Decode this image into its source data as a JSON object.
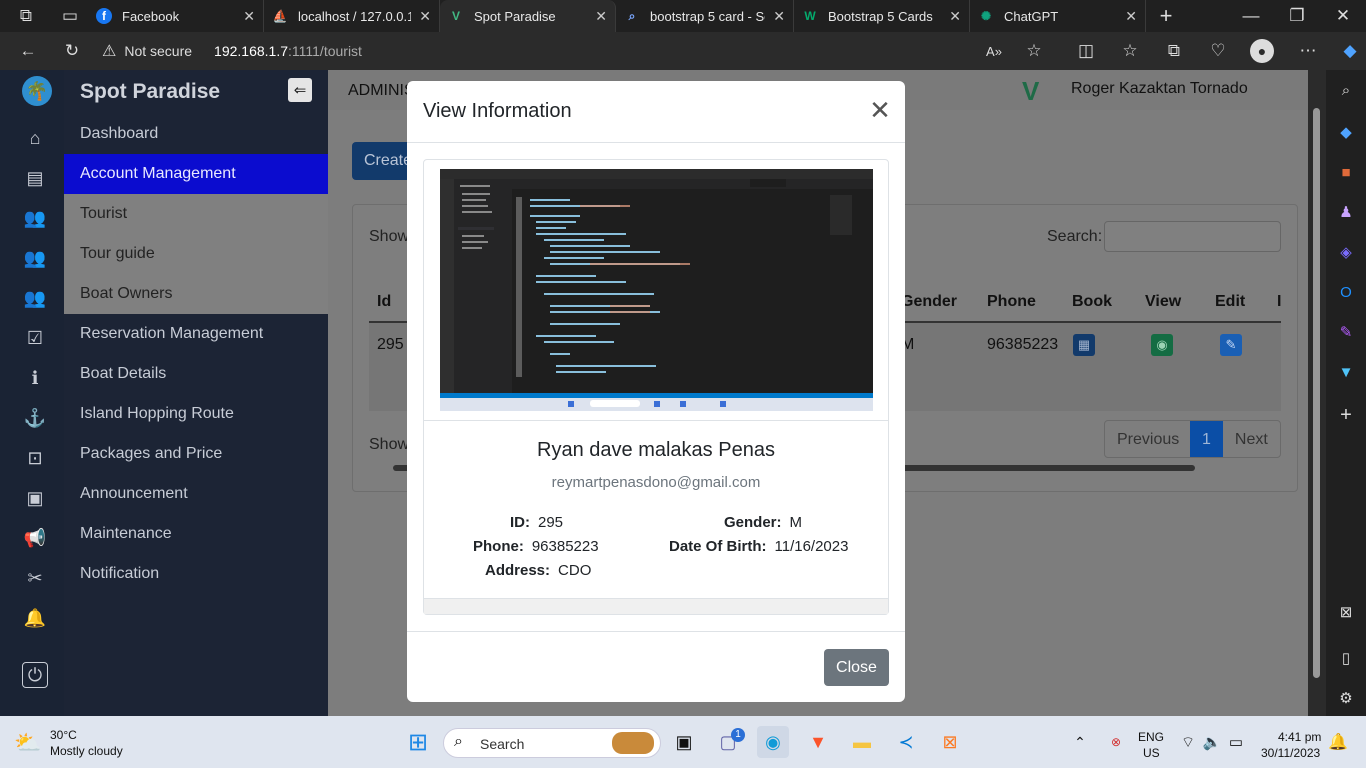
{
  "browser": {
    "tabs": [
      {
        "label": "Facebook"
      },
      {
        "label": "localhost / 127.0.0.1 /"
      },
      {
        "label": "Spot Paradise"
      },
      {
        "label": "bootstrap 5 card - Se"
      },
      {
        "label": "Bootstrap 5 Cards"
      },
      {
        "label": "ChatGPT"
      }
    ],
    "security": "Not secure",
    "url_host": "192.168.1.7",
    "url_rest": ":1111/tourist"
  },
  "sidebar": {
    "brand": "Spot Paradise",
    "items": [
      {
        "label": "Dashboard"
      },
      {
        "label": "Account Management"
      },
      {
        "label": "Tourist"
      },
      {
        "label": "Tour guide"
      },
      {
        "label": "Boat Owners"
      },
      {
        "label": "Reservation Management"
      },
      {
        "label": "Boat Details"
      },
      {
        "label": "Island Hopping Route"
      },
      {
        "label": "Packages and Price"
      },
      {
        "label": "Announcement"
      },
      {
        "label": "Maintenance"
      },
      {
        "label": "Notification"
      }
    ]
  },
  "header": {
    "admin_label": "ADMINIS",
    "user_name": "Roger Kazaktan Tornado"
  },
  "table": {
    "create_label": "Create",
    "show_label": "Show",
    "show_label2": "Show",
    "search_label": "Search:",
    "columns": [
      "Id",
      "Gender",
      "Phone",
      "Book",
      "View",
      "Edit",
      "I"
    ],
    "row": {
      "id": "295",
      "gender": "M",
      "phone": "96385223"
    },
    "pagination": {
      "previous": "Previous",
      "page": "1",
      "next": "Next"
    }
  },
  "modal": {
    "title": "View Information",
    "name": "Ryan dave malakas Penas",
    "email": "reymartpenasdono@gmail.com",
    "fields": {
      "id_label": "ID:",
      "id_value": "295",
      "gender_label": "Gender:",
      "gender_value": "M",
      "phone_label": "Phone:",
      "phone_value": "96385223",
      "dob_label": "Date Of Birth:",
      "dob_value": "11/16/2023",
      "address_label": "Address:",
      "address_value": "CDO"
    },
    "close_label": "Close"
  },
  "taskbar": {
    "weather_temp": "30°C",
    "weather_desc": "Mostly cloudy",
    "search_label": "Search",
    "lang1": "ENG",
    "lang2": "US",
    "time": "4:41 pm",
    "date": "30/11/2023",
    "chat_badge": "1"
  },
  "colors": {
    "accent_blue": "#0b0ccf",
    "sidebar_bg": "#1c2435",
    "close_button": "#6c757d",
    "pagination_active": "#0d6efd"
  }
}
